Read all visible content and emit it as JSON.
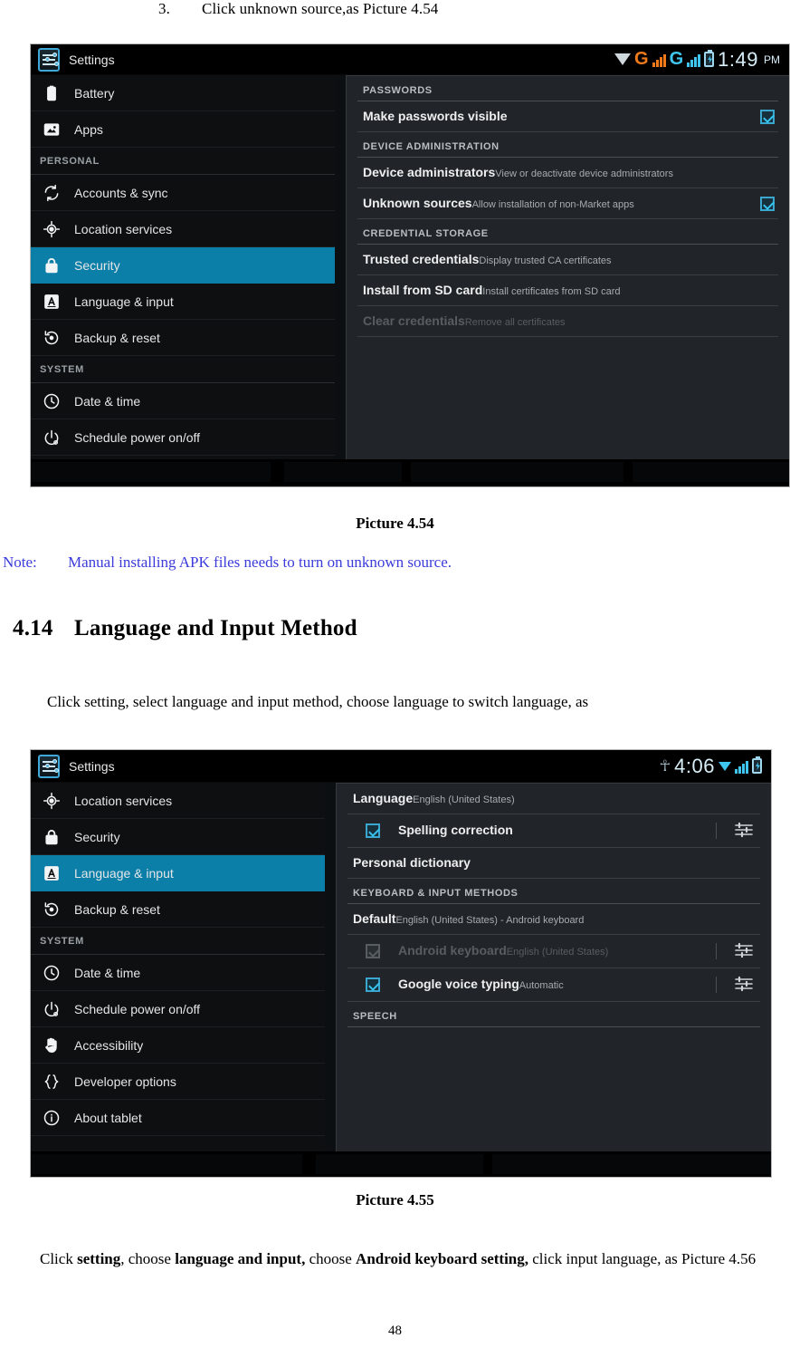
{
  "document": {
    "step": {
      "number": "3.",
      "text": "Click unknown source,as Picture 4.54"
    },
    "caption_1": "Picture 4.54",
    "note": {
      "label": "Note:",
      "text": "Manual installing APK files needs to turn on unknown source."
    },
    "section": {
      "number": "4.14",
      "title": "Language and Input Method"
    },
    "paragraph_1": "Click setting, select language and input method, choose language to switch language, as",
    "caption_2": "Picture 4.55",
    "paragraph_2": {
      "t1": "Click ",
      "b1": "setting",
      "t2": ", choose ",
      "b2": "language and input,",
      "t3": " choose ",
      "b3": "Android keyboard setting,",
      "t4": " click input language, as Picture 4.56"
    },
    "page_number": "48",
    "note_color": "#3b3bdb",
    "accent_color": "#0c7fa8"
  },
  "screenshot_1": {
    "statusbar": {
      "app_title": "Settings",
      "app_icon": "settings-sliders-icon",
      "icons": [
        "wifi-icon",
        "signal-g-orange-icon",
        "signal-g-blue-icon",
        "battery-charging-icon"
      ],
      "g_label_1": "G",
      "g_label_2": "G",
      "time": "1:49",
      "ampm": "PM"
    },
    "nav": [
      {
        "type": "item",
        "label": "Battery",
        "icon": "battery-icon",
        "selected": false
      },
      {
        "type": "item",
        "label": "Apps",
        "icon": "apps-icon",
        "selected": false
      },
      {
        "type": "group",
        "label": "PERSONAL"
      },
      {
        "type": "item",
        "label": "Accounts & sync",
        "icon": "sync-icon",
        "selected": false
      },
      {
        "type": "item",
        "label": "Location services",
        "icon": "location-icon",
        "selected": false
      },
      {
        "type": "item",
        "label": "Security",
        "icon": "lock-icon",
        "selected": true
      },
      {
        "type": "item",
        "label": "Language & input",
        "icon": "language-a-icon",
        "selected": false
      },
      {
        "type": "item",
        "label": "Backup & reset",
        "icon": "backup-icon",
        "selected": false
      },
      {
        "type": "group",
        "label": "SYSTEM"
      },
      {
        "type": "item",
        "label": "Date & time",
        "icon": "clock-icon",
        "selected": false
      },
      {
        "type": "item",
        "label": "Schedule power on/off",
        "icon": "power-icon",
        "selected": false
      }
    ],
    "detail": [
      {
        "type": "header",
        "label": "PASSWORDS"
      },
      {
        "type": "row",
        "title": "Make passwords visible",
        "sub": "",
        "checkbox": "checked",
        "disabled": false
      },
      {
        "type": "header",
        "label": "DEVICE ADMINISTRATION"
      },
      {
        "type": "row",
        "title": "Device administrators",
        "sub": "View or deactivate device administrators",
        "checkbox": "none",
        "disabled": false
      },
      {
        "type": "row",
        "title": "Unknown sources",
        "sub": "Allow installation of non-Market apps",
        "checkbox": "checked",
        "disabled": false
      },
      {
        "type": "header",
        "label": "CREDENTIAL STORAGE"
      },
      {
        "type": "row",
        "title": "Trusted credentials",
        "sub": "Display trusted CA certificates",
        "checkbox": "none",
        "disabled": false
      },
      {
        "type": "row",
        "title": "Install from SD card",
        "sub": "Install certificates from SD card",
        "checkbox": "none",
        "disabled": false
      },
      {
        "type": "row",
        "title": "Clear credentials",
        "sub": "Remove all certificates",
        "checkbox": "none",
        "disabled": true
      }
    ]
  },
  "screenshot_2": {
    "statusbar": {
      "app_title": "Settings",
      "app_icon": "settings-sliders-icon",
      "icons": [
        "usb-icon",
        "wifi-icon",
        "signal-icon",
        "battery-icon"
      ],
      "time": "4:06",
      "ampm": ""
    },
    "nav": [
      {
        "type": "item",
        "label": "Location services",
        "icon": "location-icon",
        "selected": false
      },
      {
        "type": "item",
        "label": "Security",
        "icon": "lock-icon",
        "selected": false
      },
      {
        "type": "item",
        "label": "Language & input",
        "icon": "language-a-icon",
        "selected": true
      },
      {
        "type": "item",
        "label": "Backup & reset",
        "icon": "backup-icon",
        "selected": false
      },
      {
        "type": "group",
        "label": "SYSTEM"
      },
      {
        "type": "item",
        "label": "Date & time",
        "icon": "clock-icon",
        "selected": false
      },
      {
        "type": "item",
        "label": "Schedule power on/off",
        "icon": "power-icon",
        "selected": false
      },
      {
        "type": "item",
        "label": "Accessibility",
        "icon": "hand-icon",
        "selected": false
      },
      {
        "type": "item",
        "label": "Developer options",
        "icon": "braces-icon",
        "selected": false
      },
      {
        "type": "item",
        "label": "About tablet",
        "icon": "info-icon",
        "selected": false
      }
    ],
    "detail": [
      {
        "type": "row",
        "title": "Language",
        "sub": "English (United States)",
        "checkbox": "none",
        "settings": false,
        "disabled": false,
        "indent": false
      },
      {
        "type": "row",
        "title": "Spelling correction",
        "sub": "",
        "checkbox": "checked",
        "settings": true,
        "disabled": false,
        "indent": true
      },
      {
        "type": "row",
        "title": "Personal dictionary",
        "sub": "",
        "checkbox": "none",
        "settings": false,
        "disabled": false,
        "indent": false
      },
      {
        "type": "header",
        "label": "KEYBOARD & INPUT METHODS"
      },
      {
        "type": "row",
        "title": "Default",
        "sub": "English (United States) - Android keyboard",
        "checkbox": "none",
        "settings": false,
        "disabled": false,
        "indent": false
      },
      {
        "type": "row",
        "title": "Android keyboard",
        "sub": "English (United States)",
        "checkbox": "off",
        "settings": true,
        "disabled": true,
        "indent": true
      },
      {
        "type": "row",
        "title": "Google voice typing",
        "sub": "Automatic",
        "checkbox": "checked",
        "settings": true,
        "disabled": false,
        "indent": true
      },
      {
        "type": "header",
        "label": "SPEECH"
      }
    ]
  }
}
